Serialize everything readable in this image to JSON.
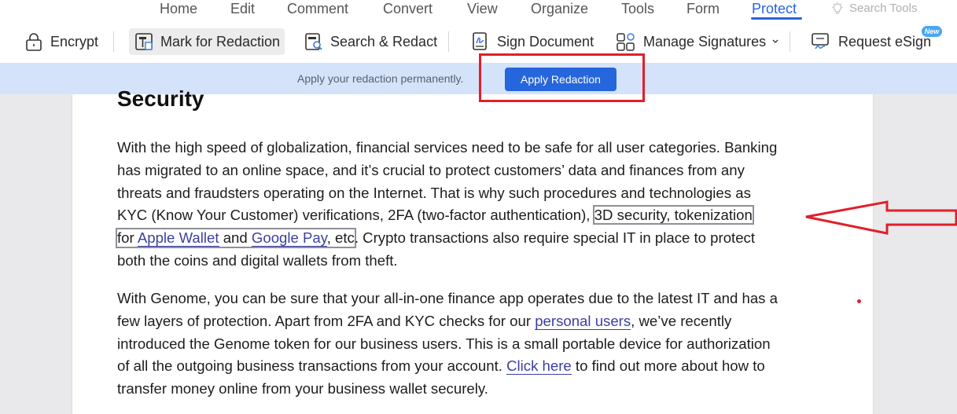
{
  "menu": {
    "items": [
      "Home",
      "Edit",
      "Comment",
      "Convert",
      "View",
      "Organize",
      "Tools",
      "Form",
      "Protect"
    ],
    "active": "Protect",
    "search_tools": "Search Tools"
  },
  "toolbar": {
    "encrypt": "Encrypt",
    "mark_for_redaction": "Mark for Redaction",
    "search_redact": "Search & Redact",
    "sign_document": "Sign Document",
    "manage_signatures": "Manage Signatures",
    "request_esign": "Request eSign",
    "new_badge": "New"
  },
  "banner": {
    "text": "Apply your redaction permanently.",
    "apply_button": "Apply Redaction"
  },
  "document": {
    "heading": "Security",
    "p1": {
      "l1": "With the high speed of globalization, financial services need to be safe for all user categories. Banking",
      "l2": "has migrated to an online space, and it’s crucial to protect customers’ data and finances from any",
      "l3": "threats and fraudsters operating on the Internet. That is why such procedures and technologies as",
      "l4_a": "KYC (Know Your Customer) verifications, 2FA (two-factor authentication), ",
      "l4_mark": "3D security, tokenization",
      "l5_for": "for ",
      "l5_link1": "Apple Wallet",
      "l5_and": " and ",
      "l5_link2": "Google Pay",
      "l5_etc": ", etc",
      "l5_rest": ". Crypto transactions also require special IT in place to protect",
      "l6": "both the coins and digital wallets from theft."
    },
    "p2": {
      "l1": "With Genome, you can be sure that your all-in-one finance app operates due to the latest IT and has a",
      "l2_a": "few layers of protection. Apart from 2FA and KYC checks for our ",
      "l2_link": "personal users",
      "l2_b": ", we’ve recently",
      "l3": "introduced the Genome token for our business users. This is a small portable device for authorization",
      "l4_a": "of all the outgoing business transactions from your account. ",
      "l4_link": "Click here",
      "l4_b": " to find out more about how to",
      "l5": "transfer money online from your business wallet securely."
    }
  },
  "colors": {
    "accent": "#2b63e0",
    "apply_button": "#2566dc",
    "banner_bg": "#d4e3fa",
    "annotation_red": "#e0202a",
    "link": "#3b3fa3"
  }
}
